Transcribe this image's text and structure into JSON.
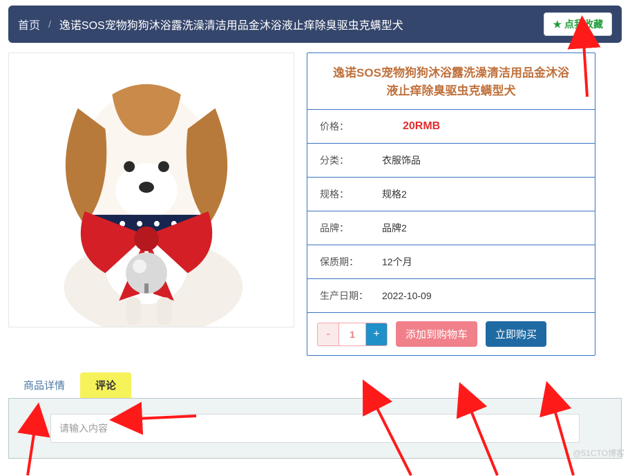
{
  "breadcrumb": {
    "home": "首页",
    "sep": "/",
    "title": "逸诺SOS宠物狗狗沐浴露洗澡清洁用品金沐浴液止痒除臭驱虫克螨型犬"
  },
  "favorite": {
    "star": "★",
    "label": "点我收藏"
  },
  "product": {
    "title": "逸诺SOS宠物狗狗沐浴露洗澡清洁用品金沐浴液止痒除臭驱虫克螨型犬",
    "price_label": "价格：",
    "price_value": "20RMB",
    "category_label": "分类：",
    "category_value": "衣服饰品",
    "spec_label": "规格：",
    "spec_value": "规格2",
    "brand_label": "品牌：",
    "brand_value": "品牌2",
    "shelf_label": "保质期：",
    "shelf_value": "12个月",
    "mfg_label": "生产日期：",
    "mfg_value": "2022-10-09"
  },
  "qty": {
    "minus": "-",
    "value": "1",
    "plus": "+"
  },
  "buttons": {
    "add_to_cart": "添加到购物车",
    "buy_now": "立即购买"
  },
  "tabs": {
    "details": "商品详情",
    "comments": "评论"
  },
  "comment_placeholder": "请输入内容",
  "watermark": "@51CTO博客"
}
